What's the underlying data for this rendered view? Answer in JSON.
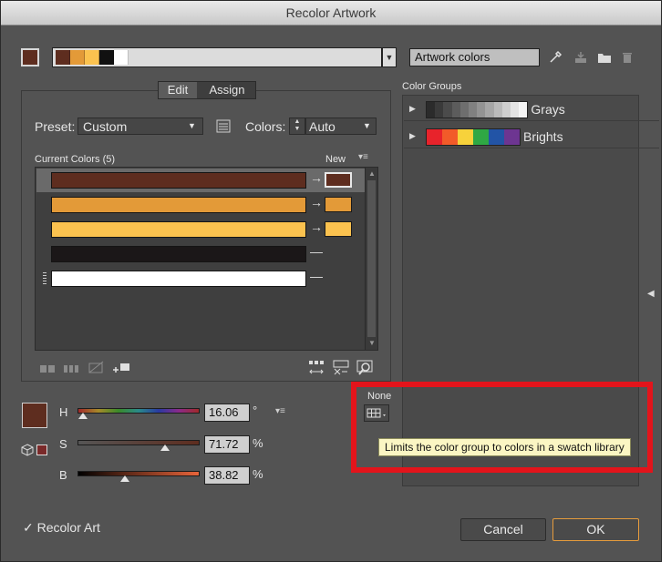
{
  "window": {
    "title": "Recolor Artwork"
  },
  "top": {
    "artwork_colors_value": "Artwork colors",
    "main_swatch_color": "#5e2d1f",
    "strip_colors": [
      "#5e2d1f",
      "#e39a38",
      "#fbc24f",
      "#111111",
      "#ffffff"
    ]
  },
  "tabs": {
    "edit": "Edit",
    "assign": "Assign"
  },
  "preset": {
    "label": "Preset:",
    "value": "Custom"
  },
  "colors": {
    "label": "Colors:",
    "value": "Auto"
  },
  "current_colors": {
    "header": "Current Colors (5)",
    "new_label": "New",
    "rows": [
      {
        "color": "#5e2d1f",
        "new": "#5e2d1f",
        "mapped": true,
        "selected": true
      },
      {
        "color": "#e39a38",
        "new": "#e39a38",
        "mapped": true,
        "selected": false
      },
      {
        "color": "#fbc24f",
        "new": "#fbc24f",
        "mapped": true,
        "selected": false
      },
      {
        "color": "#1b1718",
        "new": null,
        "mapped": false,
        "selected": false
      },
      {
        "color": "#ffffff",
        "new": null,
        "mapped": false,
        "selected": false
      }
    ]
  },
  "hsb": {
    "h_label": "H",
    "h_value": "16.06",
    "h_unit": "°",
    "s_label": "S",
    "s_value": "71.72",
    "s_unit": "%",
    "b_label": "B",
    "b_value": "38.82",
    "b_unit": "%",
    "h_pct": 0.045,
    "s_pct": 0.72,
    "b_pct": 0.39
  },
  "limit": {
    "none_label": "None",
    "tooltip": "Limits the color group to colors in a swatch library"
  },
  "color_groups": {
    "header": "Color Groups",
    "groups": [
      {
        "name": "Grays",
        "colors": [
          "#2b2b2b",
          "#3a3a3a",
          "#4b4b4b",
          "#5c5c5c",
          "#6e6e6e",
          "#808080",
          "#939393",
          "#a6a6a6",
          "#bababa",
          "#cfcfcf",
          "#e3e3e3",
          "#f5f5f5"
        ]
      },
      {
        "name": "Brights",
        "colors": [
          "#e8232b",
          "#f25b29",
          "#f7d23b",
          "#2fa844",
          "#2254a6",
          "#6d3591"
        ]
      }
    ]
  },
  "footer": {
    "recolor_art": "Recolor Art",
    "cancel": "Cancel",
    "ok": "OK"
  },
  "accent": {
    "highlight_red": "#e3141b",
    "ok_border": "#e59b3c"
  }
}
